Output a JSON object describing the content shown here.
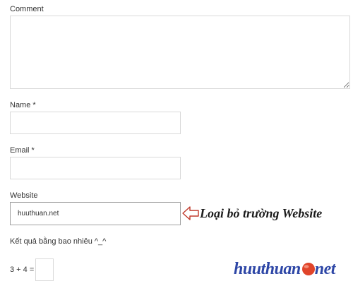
{
  "form": {
    "comment": {
      "label": "Comment",
      "value": ""
    },
    "name": {
      "label": "Name *",
      "value": ""
    },
    "email": {
      "label": "Email *",
      "value": ""
    },
    "website": {
      "label": "Website",
      "value": "huuthuan.net"
    },
    "captcha": {
      "prompt": "Kết quả bằng bao nhiêu ^_^",
      "question": "3 + 4 =",
      "value": ""
    }
  },
  "annotation": {
    "text": "Loại bỏ trường Website",
    "arrow_icon": "left-arrow-outline-icon",
    "arrow_color": "#c0392b"
  },
  "watermark": {
    "text_before": "huuthuan",
    "text_after": "net",
    "ball_icon": "red-ball-icon",
    "color": "#2d46a6",
    "ball_color": "#e0442a"
  }
}
